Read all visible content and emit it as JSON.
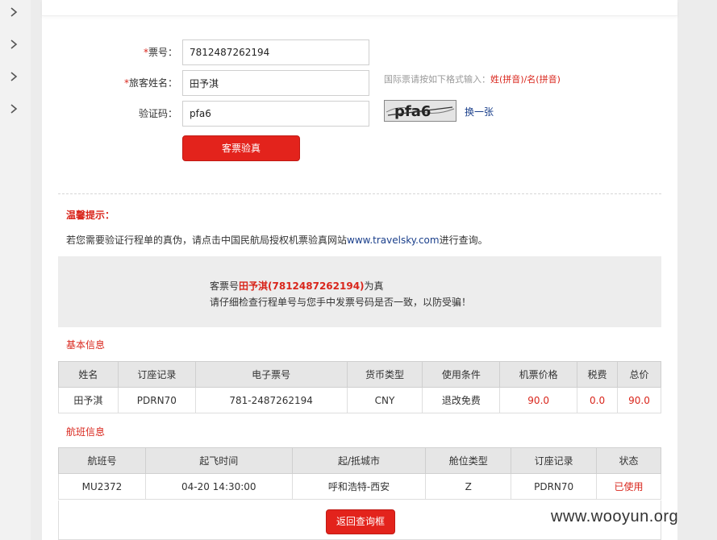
{
  "form": {
    "ticket_label_req": "*",
    "ticket_label": "票号：",
    "ticket_value": "7812487262194",
    "name_label_req": "*",
    "name_label": "旅客姓名：",
    "name_value": "田予淇",
    "code_label": "验证码：",
    "code_value": "pfa6",
    "hint_prefix": "国际票请按如下格式输入：",
    "hint_format": "姓(拼音)/名(拼音)",
    "captcha_text": "pfa6",
    "change_label": "换一张",
    "verify_button": "客票验真"
  },
  "tip": {
    "title": "温馨提示：",
    "text_prefix": "若您需要验证行程单的真伪，请点击中国民航局授权机票验真网站",
    "site": "www.travelsky.com",
    "text_suffix": "进行查询。"
  },
  "result": {
    "prefix": "客票号",
    "name_ticket": "田予淇(7812487262194)",
    "suffix": "为真",
    "line2": "请仔细检查行程单号与您手中发票号码是否一致，以防受骗！"
  },
  "basic": {
    "title": "基本信息",
    "headers": [
      "姓名",
      "订座记录",
      "电子票号",
      "货币类型",
      "使用条件",
      "机票价格",
      "税费",
      "总价"
    ],
    "row": [
      "田予淇",
      "PDRN70",
      "781-2487262194",
      "CNY",
      "退改免费",
      "90.0",
      "0.0",
      "90.0"
    ]
  },
  "flight": {
    "title": "航班信息",
    "headers": [
      "航班号",
      "起飞时间",
      "起/抵城市",
      "舱位类型",
      "订座记录",
      "状态"
    ],
    "row": [
      "MU2372",
      "04-20 14:30:00",
      "呼和浩特-西安",
      "Z",
      "PDRN70",
      "已使用"
    ]
  },
  "back_button": "返回查询框",
  "watermark": "www.wooyun.org",
  "colors": {
    "accent": "#e3231c",
    "link": "#1a3f8b",
    "panel_bg": "#ededed"
  },
  "sidebar_icons": [
    "chevron-right-icon",
    "chevron-right-icon",
    "chevron-right-icon",
    "chevron-right-icon"
  ]
}
